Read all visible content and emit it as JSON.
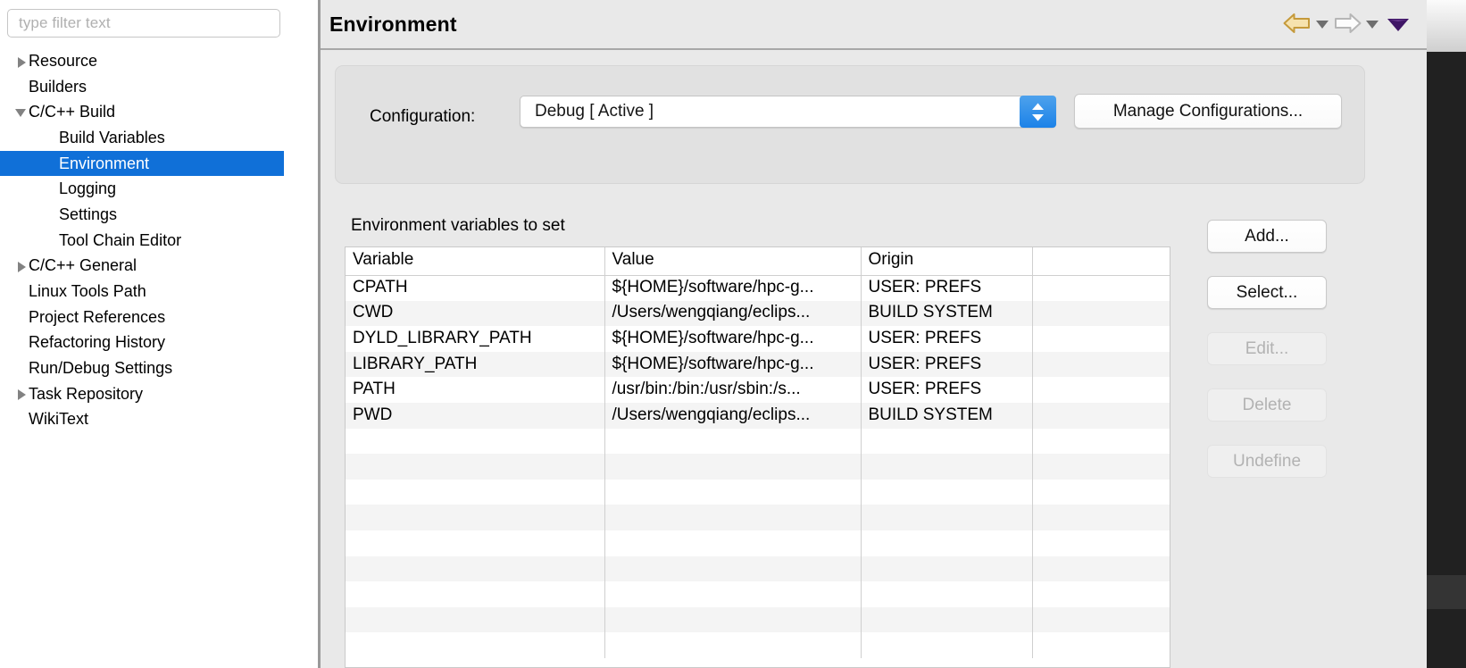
{
  "sidebar": {
    "filter": {
      "placeholder": "type filter text",
      "value": ""
    },
    "items": [
      {
        "label": "Resource",
        "twisty": "collapsed",
        "indent": 0,
        "selected": false
      },
      {
        "label": "Builders",
        "twisty": "none",
        "indent": 0,
        "selected": false
      },
      {
        "label": "C/C++ Build",
        "twisty": "expanded",
        "indent": 0,
        "selected": false
      },
      {
        "label": "Build Variables",
        "twisty": "none",
        "indent": 1,
        "selected": false
      },
      {
        "label": "Environment",
        "twisty": "none",
        "indent": 1,
        "selected": true
      },
      {
        "label": "Logging",
        "twisty": "none",
        "indent": 1,
        "selected": false
      },
      {
        "label": "Settings",
        "twisty": "none",
        "indent": 1,
        "selected": false
      },
      {
        "label": "Tool Chain Editor",
        "twisty": "none",
        "indent": 1,
        "selected": false
      },
      {
        "label": "C/C++ General",
        "twisty": "collapsed",
        "indent": 0,
        "selected": false
      },
      {
        "label": "Linux Tools Path",
        "twisty": "none",
        "indent": 0,
        "selected": false
      },
      {
        "label": "Project References",
        "twisty": "none",
        "indent": 0,
        "selected": false
      },
      {
        "label": "Refactoring History",
        "twisty": "none",
        "indent": 0,
        "selected": false
      },
      {
        "label": "Run/Debug Settings",
        "twisty": "none",
        "indent": 0,
        "selected": false
      },
      {
        "label": "Task Repository",
        "twisty": "collapsed",
        "indent": 0,
        "selected": false
      },
      {
        "label": "WikiText",
        "twisty": "none",
        "indent": 0,
        "selected": false
      }
    ]
  },
  "header": {
    "title": "Environment",
    "back_icon": "back-arrow-icon",
    "back_caret": "chevron-down-icon",
    "forward_icon": "forward-arrow-icon",
    "forward_caret": "chevron-down-icon",
    "menu_icon": "view-menu-triangle-icon"
  },
  "configuration": {
    "label": "Configuration:",
    "selected": "Debug  [ Active ]",
    "manage_label": "Manage Configurations...",
    "stepper_icon": "stepper-up-down-icon"
  },
  "table": {
    "caption": "Environment variables to set",
    "columns": [
      "Variable",
      "Value",
      "Origin",
      ""
    ],
    "rows": [
      [
        "CPATH",
        "${HOME}/software/hpc-g...",
        "USER: PREFS",
        ""
      ],
      [
        "CWD",
        "/Users/wengqiang/eclips...",
        "BUILD SYSTEM",
        ""
      ],
      [
        "DYLD_LIBRARY_PATH",
        "${HOME}/software/hpc-g...",
        "USER: PREFS",
        ""
      ],
      [
        "LIBRARY_PATH",
        "${HOME}/software/hpc-g...",
        "USER: PREFS",
        ""
      ],
      [
        "PATH",
        "/usr/bin:/bin:/usr/sbin:/s...",
        "USER: PREFS",
        ""
      ],
      [
        "PWD",
        "/Users/wengqiang/eclips...",
        "BUILD SYSTEM",
        ""
      ],
      [
        "",
        "",
        "",
        ""
      ],
      [
        "",
        "",
        "",
        ""
      ],
      [
        "",
        "",
        "",
        ""
      ],
      [
        "",
        "",
        "",
        ""
      ],
      [
        "",
        "",
        "",
        ""
      ],
      [
        "",
        "",
        "",
        ""
      ],
      [
        "",
        "",
        "",
        ""
      ],
      [
        "",
        "",
        "",
        ""
      ],
      [
        "",
        "",
        "",
        ""
      ]
    ]
  },
  "side_buttons": [
    {
      "label": "Add...",
      "enabled": true
    },
    {
      "label": "Select...",
      "enabled": true
    },
    {
      "label": "Edit...",
      "enabled": false
    },
    {
      "label": "Delete",
      "enabled": false
    },
    {
      "label": "Undefine",
      "enabled": false
    }
  ],
  "colors": {
    "selection_blue": "#1070d8",
    "panel_gray": "#e9e9e9",
    "stepper_blue": "#1c82e8",
    "back_arrow_gold": "#e8b44a",
    "menu_triangle_purple": "#3f1566"
  }
}
